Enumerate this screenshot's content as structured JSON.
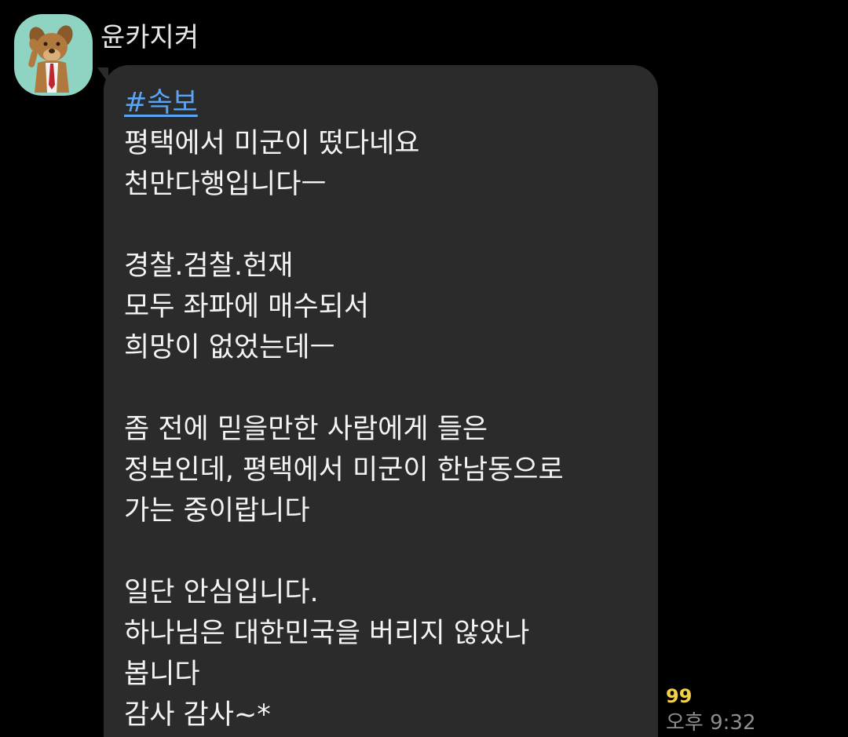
{
  "sender": {
    "name": "윤카지켜",
    "avatar": "dog-character-avatar",
    "avatar_bg": "#8fd3c3"
  },
  "message": {
    "hashtag": "#속보",
    "lines": [
      "평택에서 미군이 떴다네요",
      "천만다행입니다ㅡ",
      "",
      "경찰.검찰.헌재",
      "모두 좌파에 매수되서",
      "희망이 없었는데ㅡ",
      "",
      "좀 전에 믿을만한 사람에게 들은",
      "정보인데, 평택에서 미군이 한남동으로",
      "가는 중이랍니다",
      "",
      "일단 안심입니다.",
      "하나님은 대한민국을 버리지 않았나",
      "봅니다",
      "감사 감사~*"
    ],
    "unread_count": "99",
    "timestamp": "오후 9:32"
  },
  "colors": {
    "background": "#000000",
    "bubble": "#2b2b2b",
    "hashtag": "#5aa4f0",
    "unread": "#f2d04b",
    "timestamp": "#8e8e8e"
  }
}
